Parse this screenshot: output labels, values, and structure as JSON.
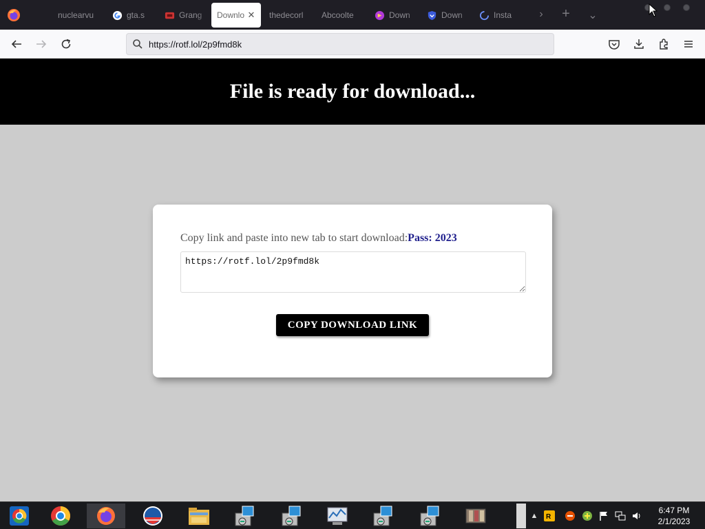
{
  "browser": {
    "tabs": [
      {
        "title": "nuclearvu",
        "icon": "generic-page-icon",
        "active": false
      },
      {
        "title": "gta.s",
        "icon": "google-icon",
        "active": false
      },
      {
        "title": "Grang",
        "icon": "game-icon",
        "active": false
      },
      {
        "title": "Downlo",
        "icon": "none",
        "active": true
      },
      {
        "title": "thedecorl",
        "icon": "none",
        "active": false
      },
      {
        "title": "Abcoolte",
        "icon": "none",
        "active": false
      },
      {
        "title": "Down",
        "icon": "colorful-app-icon",
        "active": false
      },
      {
        "title": "Down",
        "icon": "shield-icon",
        "active": false
      },
      {
        "title": "Insta",
        "icon": "loading-icon",
        "active": false
      }
    ],
    "url": "https://rotf.lol/2p9fmd8k"
  },
  "page": {
    "heading": "File is ready for download...",
    "instruction": "Copy link and paste into new tab to start download:",
    "pass_label": "Pass: 2023",
    "link_value": "https://rotf.lol/2p9fmd8k",
    "button_label": "COPY DOWNLOAD LINK"
  },
  "taskbar": {
    "time": "6:47 PM",
    "date": "2/1/2023",
    "items": [
      "chrome-beta-icon",
      "chrome-icon",
      "firefox-icon",
      "obama-logo-icon",
      "file-explorer-icon",
      "installer-icon",
      "installer-icon",
      "task-manager-icon",
      "installer-icon",
      "installer-icon",
      "archive-icon"
    ]
  },
  "colors": {
    "header_bg": "#000000",
    "page_bg": "#cccccc",
    "pass_color": "#1e1e8c",
    "tabstrip_bg": "#1f1e25"
  }
}
